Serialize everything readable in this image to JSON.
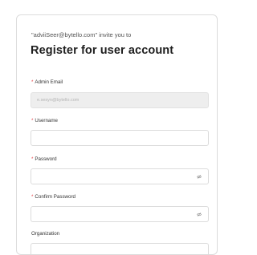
{
  "invite_text": "\"adviiSeer@bytello.com\" invite you to",
  "title": "Register for user account",
  "fields": {
    "admin_email": {
      "label": "Admin Email",
      "required": "*",
      "value": "e.sesyn@bytello.com"
    },
    "username": {
      "label": "Username",
      "required": "*",
      "value": ""
    },
    "password": {
      "label": "Password",
      "required": "*",
      "value": ""
    },
    "confirm_password": {
      "label": "Confirm Password",
      "required": "*",
      "value": ""
    },
    "organization": {
      "label": "Organization",
      "value": ""
    }
  },
  "icons": {
    "password_toggle": "eye-off-icon",
    "confirm_password_toggle": "eye-off-icon"
  },
  "colors": {
    "required_mark": "#e5484d",
    "title_text": "#1f1f1f",
    "field_border": "#dcdcdc",
    "disabled_field_bg": "#eeeeee"
  }
}
